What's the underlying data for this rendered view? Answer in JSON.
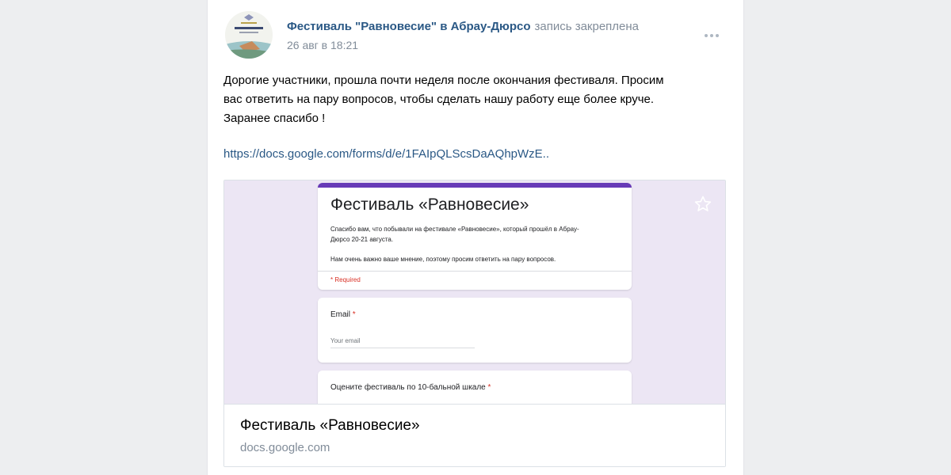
{
  "post": {
    "author": "Фестиваль \"Равновесие\" в Абрау-Дюрсо",
    "pinned_note": "запись закреплена",
    "date": "26 авг в 18:21",
    "text_lines": [
      "Дорогие участники, прошла почти неделя после окончания фестиваля. Просим",
      "вас ответить на пару вопросов, чтобы сделать нашу работу еще более круче.",
      "Заранее спасибо !"
    ],
    "link": "https://docs.google.com/forms/d/e/1FAIpQLScsDaAQhpWzE..",
    "colors": {
      "author": "#2a5885",
      "meta": "#818c99",
      "form_accent": "#673ab7",
      "preview_bg": "#ece6f4"
    },
    "icons": {
      "menu": "more-icon",
      "favorite": "star-outline-icon"
    }
  },
  "attachment": {
    "preview": {
      "form_title": "Фестиваль «Равновесие»",
      "description_line1": "Спасибо вам, что побывали на фестивале «Равновесие», который прошёл в Абрау-",
      "description_line2": "Дюрсо 20-21 августа.",
      "description_line3": "Нам очень важно ваше мнение, поэтому просим ответить на пару вопросов.",
      "required_note": "* Required",
      "email_label": "Email",
      "email_placeholder": "Your email",
      "rating_label": "Оцените фестиваль по 10-бальной шкале",
      "required_mark": "*"
    },
    "title": "Фестиваль «Равновесие»",
    "domain": "docs.google.com"
  }
}
